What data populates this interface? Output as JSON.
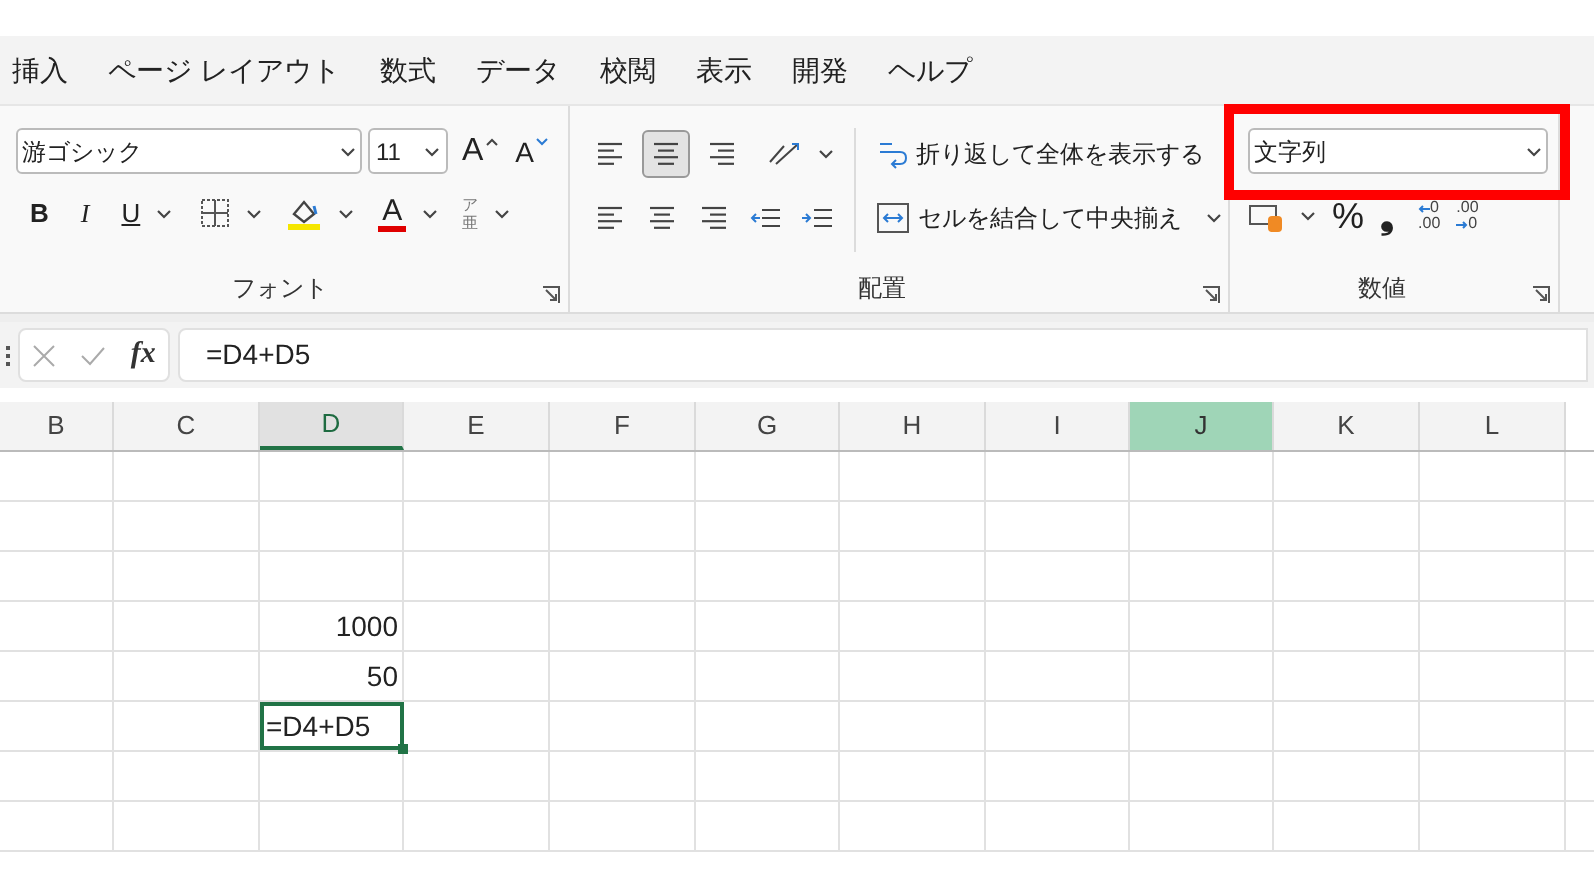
{
  "menu_tabs": [
    {
      "label": "挿入"
    },
    {
      "label": "ページ レイアウト"
    },
    {
      "label": "数式"
    },
    {
      "label": "データ"
    },
    {
      "label": "校閲"
    },
    {
      "label": "表示"
    },
    {
      "label": "開発"
    },
    {
      "label": "ヘルプ"
    }
  ],
  "font_group": {
    "font_name": "游ゴシック",
    "font_size": "11",
    "grow_label": "A",
    "shrink_label": "A",
    "bold": "B",
    "italic": "I",
    "underline": "U",
    "font_color_label": "A",
    "phonetic_top": "ア",
    "phonetic_bottom": "亜",
    "title": "フォント"
  },
  "alignment_group": {
    "middle_align_selected": true,
    "wrap_text": "折り返して全体を表示する",
    "merge_center": "セルを結合して中央揃え",
    "title": "配置"
  },
  "number_group": {
    "number_format": {
      "value": "文字列",
      "highlighted": true
    },
    "percent": "%",
    "comma": "❟",
    "increase_decimal": [
      "0",
      ".00"
    ],
    "decrease_decimal": [
      ".00",
      "0"
    ],
    "title": "数値"
  },
  "formula_bar": {
    "fx": "fx",
    "formula": "=D4+D5"
  },
  "columns": [
    {
      "label": "B",
      "kind": "plain"
    },
    {
      "label": "C",
      "kind": "plain"
    },
    {
      "label": "D",
      "kind": "active"
    },
    {
      "label": "E",
      "kind": "plain"
    },
    {
      "label": "F",
      "kind": "plain"
    },
    {
      "label": "G",
      "kind": "plain"
    },
    {
      "label": "H",
      "kind": "plain"
    },
    {
      "label": "I",
      "kind": "plain"
    },
    {
      "label": "J",
      "kind": "filled"
    },
    {
      "label": "K",
      "kind": "plain"
    },
    {
      "label": "L",
      "kind": "plain"
    }
  ],
  "rows": [
    {},
    {},
    {},
    {
      "D": {
        "value": "1000",
        "kind": "number",
        "active": false
      }
    },
    {
      "D": {
        "value": "50",
        "kind": "number",
        "active": false
      }
    },
    {
      "D": {
        "value": "=D4+D5",
        "kind": "text",
        "active": true
      }
    },
    {},
    {}
  ]
}
